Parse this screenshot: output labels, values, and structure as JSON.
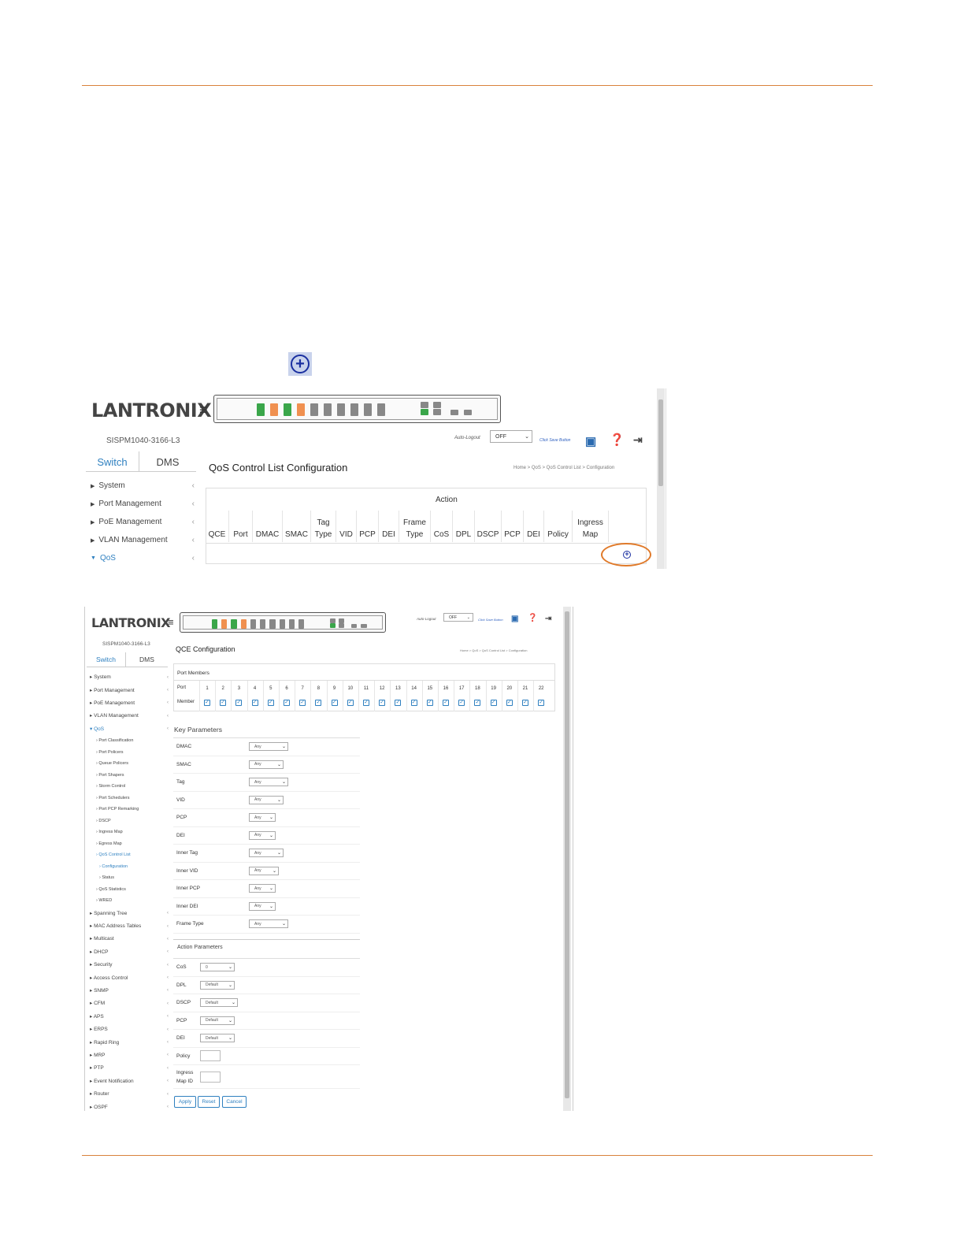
{
  "screen1": {
    "logo": "LANTRONIX",
    "model": "SISPM1040-3166-L3",
    "tabs": [
      "Switch",
      "DMS"
    ],
    "nav": [
      "System",
      "Port Management",
      "PoE Management",
      "VLAN Management",
      "QoS"
    ],
    "auto_logout_label": "Auto-Logout",
    "auto_logout_value": "OFF",
    "save_link": "Click Save Button",
    "page_title": "QoS Control List Configuration",
    "breadcrumb": "Home > QoS > QoS Control List > Configuration",
    "table": {
      "group_header": "Action",
      "columns": [
        "QCE",
        "Port",
        "DMAC",
        "SMAC",
        "Tag Type",
        "VID",
        "PCP",
        "DEI",
        "Frame Type",
        "CoS",
        "DPL",
        "DSCP",
        "PCP",
        "DEI",
        "Policy",
        "Ingress Map"
      ]
    }
  },
  "screen2": {
    "logo": "LANTRONIX",
    "model": "SISPM1040-3166-L3",
    "tabs": [
      "Switch",
      "DMS"
    ],
    "auto_logout_label": "Auto-Logout",
    "auto_logout_value": "OFF",
    "save_link": "Click Save Button",
    "page_title": "QCE Configuration",
    "breadcrumb": "Home > QoS > QoS Control List > Configuration",
    "nav": [
      {
        "label": "System",
        "level": 0
      },
      {
        "label": "Port Management",
        "level": 0
      },
      {
        "label": "PoE Management",
        "level": 0
      },
      {
        "label": "VLAN Management",
        "level": 0
      },
      {
        "label": "QoS",
        "level": 0,
        "active": true
      },
      {
        "label": "Port Classification",
        "level": 1
      },
      {
        "label": "Port Policers",
        "level": 1
      },
      {
        "label": "Queue Policers",
        "level": 1
      },
      {
        "label": "Port Shapers",
        "level": 1
      },
      {
        "label": "Storm Control",
        "level": 1
      },
      {
        "label": "Port Schedulers",
        "level": 1
      },
      {
        "label": "Port PCP Remarking",
        "level": 1
      },
      {
        "label": "DSCP",
        "level": 1
      },
      {
        "label": "Ingress Map",
        "level": 1
      },
      {
        "label": "Egress Map",
        "level": 1
      },
      {
        "label": "QoS Control List",
        "level": 1,
        "active": true
      },
      {
        "label": "Configuration",
        "level": 2,
        "active": true
      },
      {
        "label": "Status",
        "level": 2
      },
      {
        "label": "QoS Statistics",
        "level": 1
      },
      {
        "label": "WRED",
        "level": 1
      },
      {
        "label": "Spanning Tree",
        "level": 0
      },
      {
        "label": "MAC Address Tables",
        "level": 0
      },
      {
        "label": "Multicast",
        "level": 0
      },
      {
        "label": "DHCP",
        "level": 0
      },
      {
        "label": "Security",
        "level": 0
      },
      {
        "label": "Access Control",
        "level": 0
      },
      {
        "label": "SNMP",
        "level": 0
      },
      {
        "label": "CFM",
        "level": 0
      },
      {
        "label": "APS",
        "level": 0
      },
      {
        "label": "ERPS",
        "level": 0
      },
      {
        "label": "Rapid Ring",
        "level": 0
      },
      {
        "label": "MRP",
        "level": 0
      },
      {
        "label": "PTP",
        "level": 0
      },
      {
        "label": "Event Notification",
        "level": 0
      },
      {
        "label": "Router",
        "level": 0
      },
      {
        "label": "OSPF",
        "level": 0
      }
    ],
    "port_members": {
      "title": "Port Members",
      "port_label": "Port",
      "member_label": "Member",
      "ports": [
        "1",
        "2",
        "3",
        "4",
        "5",
        "6",
        "7",
        "8",
        "9",
        "10",
        "11",
        "12",
        "13",
        "14",
        "15",
        "16",
        "17",
        "18",
        "19",
        "20",
        "21",
        "22"
      ]
    },
    "key_parameters": {
      "title": "Key Parameters",
      "rows": [
        {
          "label": "DMAC",
          "value": "Any"
        },
        {
          "label": "SMAC",
          "value": "Any"
        },
        {
          "label": "Tag",
          "value": "Any"
        },
        {
          "label": "VID",
          "value": "Any"
        },
        {
          "label": "PCP",
          "value": "Any"
        },
        {
          "label": "DEI",
          "value": "Any"
        },
        {
          "label": "Inner Tag",
          "value": "Any"
        },
        {
          "label": "Inner VID",
          "value": "Any"
        },
        {
          "label": "Inner PCP",
          "value": "Any"
        },
        {
          "label": "Inner DEI",
          "value": "Any"
        },
        {
          "label": "Frame Type",
          "value": "Any"
        }
      ]
    },
    "action_parameters": {
      "title": "Action Parameters",
      "rows": [
        {
          "label": "CoS",
          "value": "0"
        },
        {
          "label": "DPL",
          "value": "Default"
        },
        {
          "label": "DSCP",
          "value": "Default"
        },
        {
          "label": "PCP",
          "value": "Default"
        },
        {
          "label": "DEI",
          "value": "Default"
        },
        {
          "label": "Policy",
          "value": ""
        },
        {
          "label": "Ingress Map ID",
          "value": ""
        }
      ]
    },
    "buttons": [
      "Apply",
      "Reset",
      "Cancel"
    ]
  }
}
